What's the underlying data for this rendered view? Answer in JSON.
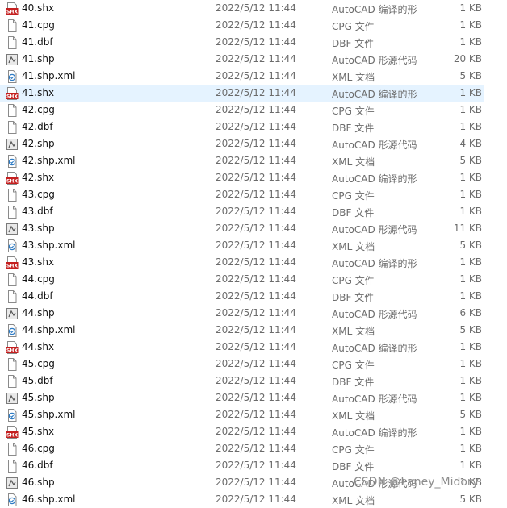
{
  "watermark": "CSDN @Laney_Midory",
  "colors": {
    "selected_row": "#e5f3ff",
    "shx_icon_red": "#c41f1f",
    "meta_text": "#6b6b6b"
  },
  "files": [
    {
      "name": "40.shx",
      "date": "2022/5/12 11:44",
      "type": "AutoCAD 编译的形",
      "size": "1 KB",
      "icon": "shx-icon"
    },
    {
      "name": "41.cpg",
      "date": "2022/5/12 11:44",
      "type": "CPG 文件",
      "size": "1 KB",
      "icon": "file-icon"
    },
    {
      "name": "41.dbf",
      "date": "2022/5/12 11:44",
      "type": "DBF 文件",
      "size": "1 KB",
      "icon": "file-icon"
    },
    {
      "name": "41.shp",
      "date": "2022/5/12 11:44",
      "type": "AutoCAD 形源代码",
      "size": "20 KB",
      "icon": "shp-icon"
    },
    {
      "name": "41.shp.xml",
      "date": "2022/5/12 11:44",
      "type": "XML 文档",
      "size": "5 KB",
      "icon": "xml-icon"
    },
    {
      "name": "41.shx",
      "date": "2022/5/12 11:44",
      "type": "AutoCAD 编译的形",
      "size": "1 KB",
      "icon": "shx-icon",
      "selected": true
    },
    {
      "name": "42.cpg",
      "date": "2022/5/12 11:44",
      "type": "CPG 文件",
      "size": "1 KB",
      "icon": "file-icon"
    },
    {
      "name": "42.dbf",
      "date": "2022/5/12 11:44",
      "type": "DBF 文件",
      "size": "1 KB",
      "icon": "file-icon"
    },
    {
      "name": "42.shp",
      "date": "2022/5/12 11:44",
      "type": "AutoCAD 形源代码",
      "size": "4 KB",
      "icon": "shp-icon"
    },
    {
      "name": "42.shp.xml",
      "date": "2022/5/12 11:44",
      "type": "XML 文档",
      "size": "5 KB",
      "icon": "xml-icon"
    },
    {
      "name": "42.shx",
      "date": "2022/5/12 11:44",
      "type": "AutoCAD 编译的形",
      "size": "1 KB",
      "icon": "shx-icon"
    },
    {
      "name": "43.cpg",
      "date": "2022/5/12 11:44",
      "type": "CPG 文件",
      "size": "1 KB",
      "icon": "file-icon"
    },
    {
      "name": "43.dbf",
      "date": "2022/5/12 11:44",
      "type": "DBF 文件",
      "size": "1 KB",
      "icon": "file-icon"
    },
    {
      "name": "43.shp",
      "date": "2022/5/12 11:44",
      "type": "AutoCAD 形源代码",
      "size": "11 KB",
      "icon": "shp-icon"
    },
    {
      "name": "43.shp.xml",
      "date": "2022/5/12 11:44",
      "type": "XML 文档",
      "size": "5 KB",
      "icon": "xml-icon"
    },
    {
      "name": "43.shx",
      "date": "2022/5/12 11:44",
      "type": "AutoCAD 编译的形",
      "size": "1 KB",
      "icon": "shx-icon"
    },
    {
      "name": "44.cpg",
      "date": "2022/5/12 11:44",
      "type": "CPG 文件",
      "size": "1 KB",
      "icon": "file-icon"
    },
    {
      "name": "44.dbf",
      "date": "2022/5/12 11:44",
      "type": "DBF 文件",
      "size": "1 KB",
      "icon": "file-icon"
    },
    {
      "name": "44.shp",
      "date": "2022/5/12 11:44",
      "type": "AutoCAD 形源代码",
      "size": "6 KB",
      "icon": "shp-icon"
    },
    {
      "name": "44.shp.xml",
      "date": "2022/5/12 11:44",
      "type": "XML 文档",
      "size": "5 KB",
      "icon": "xml-icon"
    },
    {
      "name": "44.shx",
      "date": "2022/5/12 11:44",
      "type": "AutoCAD 编译的形",
      "size": "1 KB",
      "icon": "shx-icon"
    },
    {
      "name": "45.cpg",
      "date": "2022/5/12 11:44",
      "type": "CPG 文件",
      "size": "1 KB",
      "icon": "file-icon"
    },
    {
      "name": "45.dbf",
      "date": "2022/5/12 11:44",
      "type": "DBF 文件",
      "size": "1 KB",
      "icon": "file-icon"
    },
    {
      "name": "45.shp",
      "date": "2022/5/12 11:44",
      "type": "AutoCAD 形源代码",
      "size": "1 KB",
      "icon": "shp-icon"
    },
    {
      "name": "45.shp.xml",
      "date": "2022/5/12 11:44",
      "type": "XML 文档",
      "size": "5 KB",
      "icon": "xml-icon"
    },
    {
      "name": "45.shx",
      "date": "2022/5/12 11:44",
      "type": "AutoCAD 编译的形",
      "size": "1 KB",
      "icon": "shx-icon"
    },
    {
      "name": "46.cpg",
      "date": "2022/5/12 11:44",
      "type": "CPG 文件",
      "size": "1 KB",
      "icon": "file-icon"
    },
    {
      "name": "46.dbf",
      "date": "2022/5/12 11:44",
      "type": "DBF 文件",
      "size": "1 KB",
      "icon": "file-icon"
    },
    {
      "name": "46.shp",
      "date": "2022/5/12 11:44",
      "type": "AutoCAD 形源代码",
      "size": "1 KB",
      "icon": "shp-icon"
    },
    {
      "name": "46.shp.xml",
      "date": "2022/5/12 11:44",
      "type": "XML 文档",
      "size": "5 KB",
      "icon": "xml-icon"
    }
  ]
}
